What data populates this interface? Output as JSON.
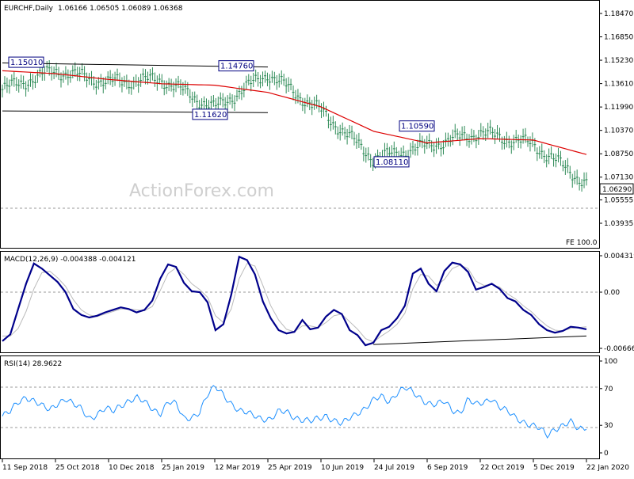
{
  "header": {
    "symbol": "EURCHF,Daily",
    "ohlc": "1.06166 1.06505 1.06089 1.06368"
  },
  "watermark": "ActionForex.com",
  "fe_label": "FE 100.0",
  "macd": {
    "title": "MACD(12,26,9) -0.004388 -0.004121",
    "ticks": [
      "0.004319",
      "0.00",
      "-0.006663"
    ]
  },
  "rsi": {
    "title": "RSI(14) 28.9622",
    "ticks": [
      "100",
      "70",
      "30",
      "0"
    ]
  },
  "colors": {
    "price_bars": "#2e8b57",
    "sma": "#dd0000",
    "macd_line": "#00008b",
    "signal_line": "#bbbbbb",
    "rsi_line": "#1e90ff",
    "label_border": "#000080"
  },
  "chart_data": [
    {
      "type": "line",
      "title": "EURCHF,Daily",
      "x_tick_labels": [
        "11 Sep 2018",
        "25 Oct 2018",
        "10 Dec 2018",
        "25 Jan 2019",
        "12 Mar 2019",
        "25 Apr 2019",
        "10 Jun 2019",
        "24 Jul 2019",
        "6 Sep 2019",
        "22 Oct 2019",
        "5 Dec 2019",
        "22 Jan 2020"
      ],
      "y_tick_labels": [
        "1.18470",
        "1.16850",
        "1.15230",
        "1.13610",
        "1.11990",
        "1.10370",
        "1.08750",
        "1.07130",
        "1.05555",
        "1.03935"
      ],
      "ylim": [
        1.03935,
        1.1847
      ],
      "current_price": "1.06290",
      "series": [
        {
          "name": "price",
          "x": [
            "11 Sep 2018",
            "25 Oct 2018",
            "10 Dec 2018",
            "25 Jan 2019",
            "12 Mar 2019",
            "25 Apr 2019",
            "10 Jun 2019",
            "24 Jul 2019",
            "6 Sep 2019",
            "22 Oct 2019",
            "5 Dec 2019",
            "22 Jan 2020"
          ],
          "values": [
            1.132,
            1.145,
            1.137,
            1.139,
            1.119,
            1.143,
            1.117,
            1.084,
            1.093,
            1.102,
            1.094,
            1.067
          ]
        },
        {
          "name": "sma",
          "x": [
            "11 Sep 2018",
            "25 Oct 2018",
            "10 Dec 2018",
            "25 Jan 2019",
            "12 Mar 2019",
            "25 Apr 2019",
            "10 Jun 2019",
            "24 Jul 2019",
            "6 Sep 2019",
            "22 Oct 2019",
            "5 Dec 2019",
            "22 Jan 2020"
          ],
          "values": [
            1.145,
            1.143,
            1.139,
            1.136,
            1.135,
            1.13,
            1.12,
            1.103,
            1.095,
            1.098,
            1.097,
            1.087
          ]
        }
      ],
      "annotations": [
        {
          "text": "1.15010",
          "x": "11 Sep 2018",
          "y": 1.1501
        },
        {
          "text": "1.14760",
          "x": "12 Mar 2019",
          "y": 1.1476
        },
        {
          "text": "1.11620",
          "x": "12 Mar 2019",
          "y": 1.1162
        },
        {
          "text": "1.10590",
          "x": "6 Sep 2019",
          "y": 1.1059
        },
        {
          "text": "1.08110",
          "x": "24 Jul 2019",
          "y": 1.0811
        }
      ],
      "trendlines": [
        {
          "from": [
            "11 Sep 2018",
            1.1504
          ],
          "to": [
            "25 Apr 2019",
            1.1476
          ]
        },
        {
          "from": [
            "11 Sep 2018",
            1.1172
          ],
          "to": [
            "25 Apr 2019",
            1.116
          ]
        }
      ],
      "grid": false
    },
    {
      "type": "line",
      "title": "MACD(12,26,9) -0.004388 -0.004121",
      "y_tick_labels": [
        "0.004319",
        "0.00",
        "-0.006663"
      ],
      "ylim": [
        -0.006663,
        0.004319
      ],
      "series": [
        {
          "name": "MACD",
          "values": [
            -0.0058,
            -0.005,
            -0.002,
            0.001,
            0.0034,
            0.0028,
            0.002,
            0.0012,
            0.0,
            -0.002,
            -0.0027,
            -0.003,
            -0.0028,
            -0.0024,
            -0.0021,
            -0.0018,
            -0.002,
            -0.0024,
            -0.0021,
            -0.001,
            0.0016,
            0.0033,
            0.003,
            0.0011,
            0.0001,
            0.0,
            -0.0012,
            -0.0045,
            -0.0038,
            -0.0003,
            0.0042,
            0.0038,
            0.0021,
            -0.0011,
            -0.0031,
            -0.0045,
            -0.0049,
            -0.0047,
            -0.0033,
            -0.0044,
            -0.0042,
            -0.0029,
            -0.0021,
            -0.0026,
            -0.0045,
            -0.0051,
            -0.0063,
            -0.006,
            -0.0045,
            -0.0041,
            -0.0031,
            -0.0016,
            0.0022,
            0.0028,
            0.001,
            0.0001,
            0.0025,
            0.0035,
            0.0033,
            0.0024,
            0.0003,
            0.0006,
            0.001,
            0.0004,
            -0.0007,
            -0.0011,
            -0.0021,
            -0.0027,
            -0.0038,
            -0.0045,
            -0.0048,
            -0.0046,
            -0.0041,
            -0.0042,
            -0.0044
          ]
        },
        {
          "name": "Signal",
          "values": [
            -0.0052,
            -0.0052,
            -0.0043,
            -0.0023,
            0.0004,
            0.0023,
            0.0025,
            0.0017,
            0.0007,
            -0.0009,
            -0.0021,
            -0.0027,
            -0.0029,
            -0.0026,
            -0.0023,
            -0.002,
            -0.002,
            -0.0021,
            -0.0022,
            -0.0017,
            0.0002,
            0.0022,
            0.0029,
            0.0021,
            0.001,
            0.0003,
            -0.0006,
            -0.0028,
            -0.0036,
            -0.002,
            0.0016,
            0.0034,
            0.0031,
            0.0008,
            -0.0016,
            -0.0033,
            -0.0044,
            -0.0047,
            -0.004,
            -0.004,
            -0.0042,
            -0.0036,
            -0.0028,
            -0.0026,
            -0.0035,
            -0.0044,
            -0.0055,
            -0.0059,
            -0.0052,
            -0.0046,
            -0.0038,
            -0.0025,
            0.0004,
            0.0021,
            0.0019,
            0.0008,
            0.0015,
            0.0028,
            0.0032,
            0.0028,
            0.0013,
            0.0008,
            0.0009,
            0.0006,
            -0.0002,
            -0.0008,
            -0.0016,
            -0.0023,
            -0.0032,
            -0.004,
            -0.0045,
            -0.0046,
            -0.0043,
            -0.0042,
            -0.0041
          ]
        }
      ],
      "trendline": {
        "from": [
          47,
          -0.0062
        ],
        "to": [
          74,
          -0.0052
        ]
      }
    },
    {
      "type": "line",
      "title": "RSI(14) 28.9622",
      "y_tick_labels": [
        "100",
        "70",
        "30",
        "0"
      ],
      "ylim": [
        0,
        100
      ],
      "reference_lines": [
        70,
        30
      ],
      "series": [
        {
          "name": "RSI",
          "values": [
            40,
            44,
            55,
            62,
            57,
            50,
            46,
            55,
            60,
            52,
            47,
            38,
            43,
            48,
            44,
            52,
            58,
            60,
            54,
            48,
            44,
            56,
            52,
            37,
            40,
            45,
            62,
            72,
            65,
            54,
            44,
            43,
            42,
            38,
            35,
            44,
            46,
            40,
            35,
            33,
            38,
            42,
            35,
            30,
            38,
            45,
            49,
            56,
            61,
            57,
            66,
            70,
            65,
            60,
            55,
            52,
            55,
            47,
            45,
            58,
            51,
            55,
            61,
            50,
            44,
            38,
            35,
            31,
            26,
            18,
            27,
            31,
            33,
            24,
            29
          ]
        }
      ]
    }
  ]
}
